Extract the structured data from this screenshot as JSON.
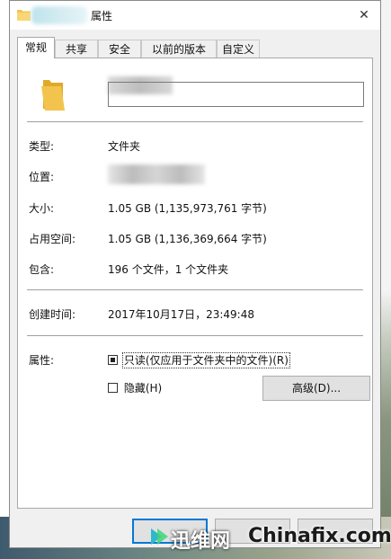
{
  "window": {
    "title": "属性",
    "close_glyph": "✕"
  },
  "tabs": [
    {
      "label": "常规",
      "active": true
    },
    {
      "label": "共享",
      "active": false
    },
    {
      "label": "安全",
      "active": false
    },
    {
      "label": "以前的版本",
      "active": false
    },
    {
      "label": "自定义",
      "active": false
    }
  ],
  "general": {
    "name_value": "",
    "type": {
      "label": "类型:",
      "value": "文件夹"
    },
    "location": {
      "label": "位置:",
      "value": ""
    },
    "size": {
      "label": "大小:",
      "value": "1.05 GB (1,135,973,761 字节)"
    },
    "size_on_disk": {
      "label": "占用空间:",
      "value": "1.05 GB (1,136,369,664 字节)"
    },
    "contains": {
      "label": "包含:",
      "value": "196 个文件，1 个文件夹"
    },
    "created": {
      "label": "创建时间:",
      "value": "2017年10月17日，23:49:48"
    },
    "attributes": {
      "label": "属性:",
      "readonly": {
        "label": "只读(仅应用于文件夹中的文件)(R)",
        "state": "indeterminate"
      },
      "hidden": {
        "label": "隐藏(H)",
        "state": "unchecked"
      },
      "advanced_button": "高级(D)..."
    }
  },
  "footer": {
    "ok_label": "",
    "cancel_label": "",
    "apply_label": ""
  },
  "watermark": {
    "brand_cn": "迅维网",
    "brand_en": "Chinafix.com"
  },
  "colors": {
    "focus_blue": "#0078d7",
    "folder_yellow": "#f3c44d"
  }
}
